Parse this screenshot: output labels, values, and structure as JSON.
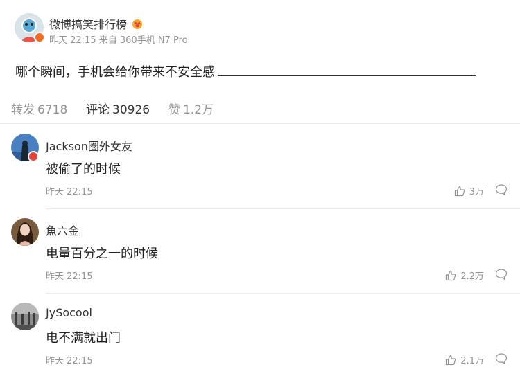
{
  "post": {
    "author": "微博搞笑排行榜",
    "time": "昨天 22:15",
    "source": "来自 360手机 N7 Pro",
    "text": "哪个瞬间，手机会给你带来不安全感"
  },
  "tabs": [
    {
      "label": "转发",
      "count": "6718"
    },
    {
      "label": "评论",
      "count": "30926"
    },
    {
      "label": "赞",
      "count": "1.2万"
    }
  ],
  "comments": [
    {
      "name": "Jackson圈外女友",
      "text": "被偷了的时候",
      "time": "昨天 22:15",
      "likes": "3万"
    },
    {
      "name": "魚六金",
      "text": "电量百分之一的时候",
      "time": "昨天 22:15",
      "likes": "2.2万"
    },
    {
      "name": "JySocool",
      "text": "电不满就出门",
      "time": "昨天 22:15",
      "likes": "2.1万"
    }
  ],
  "colors": {
    "muted": "#939393",
    "verified": "#f36b21",
    "divider": "#ececec"
  }
}
